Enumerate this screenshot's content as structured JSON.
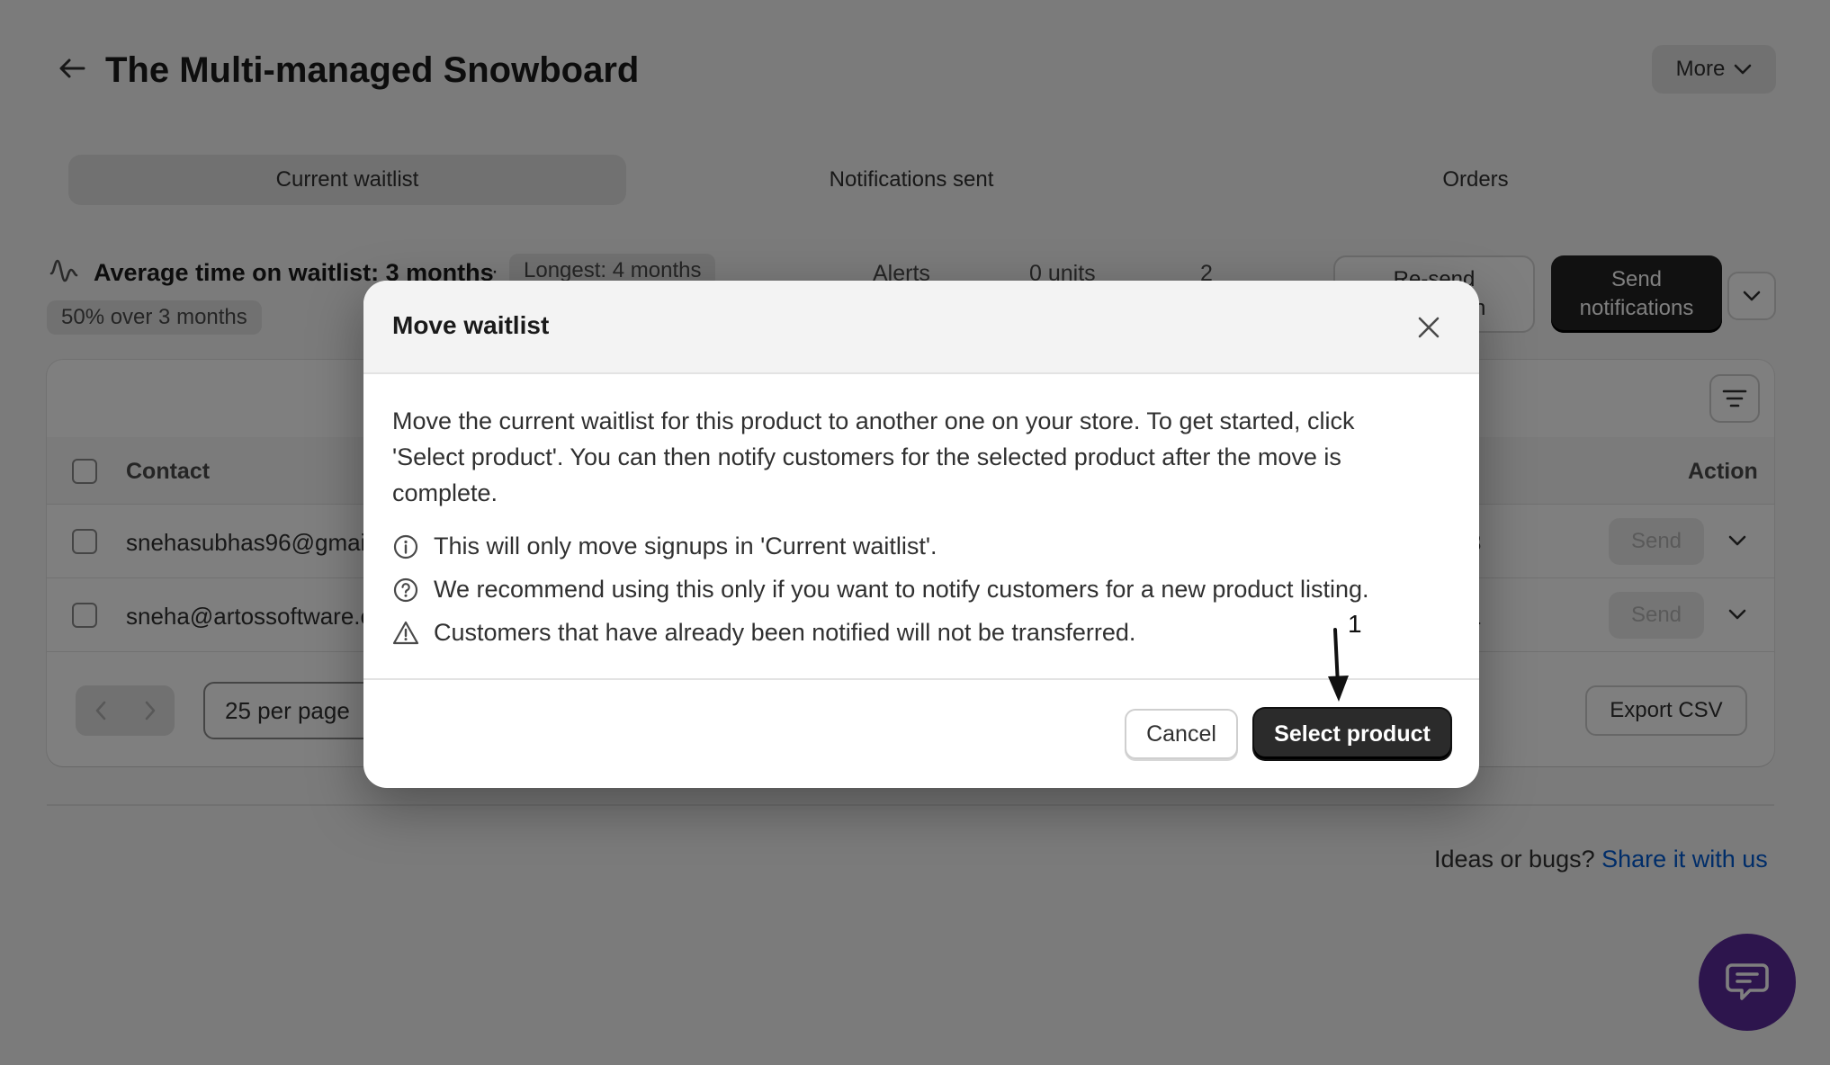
{
  "header": {
    "title": "The Multi-managed Snowboard",
    "more_label": "More"
  },
  "tabs": [
    {
      "label": "Current waitlist",
      "active": true
    },
    {
      "label": "Notifications sent",
      "active": false
    },
    {
      "label": "Orders",
      "active": false
    }
  ],
  "stats": {
    "average": "Average time on waitlist: 3 months",
    "separator": "·",
    "longest": "Longest: 4 months",
    "percent": "50% over 3 months",
    "alerts_label": "Alerts",
    "units_label": "0 units",
    "count": "2"
  },
  "actions": {
    "resend_line1": "Re-send",
    "resend_line2": "notification",
    "send_line1": "Send",
    "send_line2": "notifications"
  },
  "table": {
    "columns": {
      "contact": "Contact",
      "action": "Action"
    },
    "rows": [
      {
        "contact": "snehasubhas96@gmail.com",
        "tail": "3",
        "action": "Send"
      },
      {
        "contact": "sneha@artossoftware.com",
        "tail": "1",
        "action": "Send"
      }
    ],
    "per_page": "25 per page",
    "export_label": "Export CSV"
  },
  "footer": {
    "ideas_text": "Ideas or bugs?",
    "ideas_link": "Share it with us"
  },
  "modal": {
    "title": "Move waitlist",
    "description": "Move the current waitlist for this product to another one on your store. To get started, click 'Select product'. You can then notify customers for the selected product after the move is complete.",
    "items": [
      {
        "icon": "info-icon",
        "text": "This will only move signups in 'Current waitlist'."
      },
      {
        "icon": "question-icon",
        "text": "We recommend using this only if you want to notify customers for a new product listing."
      },
      {
        "icon": "warning-icon",
        "text": "Customers that have already been notified will not be transferred."
      }
    ],
    "cancel_label": "Cancel",
    "select_label": "Select product"
  },
  "annotation": {
    "label": "1"
  }
}
